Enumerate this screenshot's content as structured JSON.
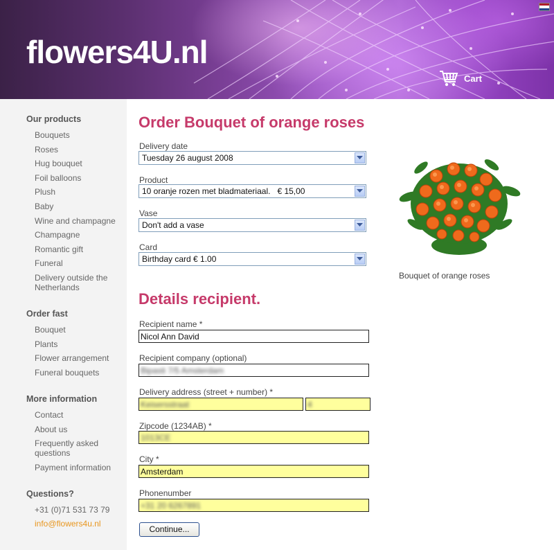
{
  "site": {
    "logo": "flowers4U.nl",
    "cart_label": "Cart"
  },
  "sidebar": {
    "sections": [
      {
        "heading": "Our products",
        "items": [
          "Bouquets",
          "Roses",
          "Hug bouquet",
          "Foil balloons",
          "Plush",
          "Baby",
          "Wine and champagne",
          "Champagne",
          "Romantic gift",
          "Funeral",
          "Delivery outside the Netherlands"
        ]
      },
      {
        "heading": "Order fast",
        "items": [
          "Bouquet",
          "Plants",
          "Flower arrangement",
          "Funeral bouquets"
        ]
      },
      {
        "heading": "More information",
        "items": [
          "Contact",
          "About us",
          "Frequently asked questions",
          "Payment information"
        ]
      },
      {
        "heading": "Questions?",
        "items": [
          "+31 (0)71 531 73 79",
          "info@flowers4u.nl"
        ]
      }
    ]
  },
  "order": {
    "title": "Order Bouquet of orange roses",
    "fields": [
      {
        "label": "Delivery date",
        "value": "Tuesday 26 august 2008"
      },
      {
        "label": "Product",
        "value": "10 oranje rozen met bladmateriaal.   € 15,00"
      },
      {
        "label": "Vase",
        "value": "Don't add a vase"
      },
      {
        "label": "Card",
        "value": "Birthday card € 1.00"
      }
    ],
    "image_caption": "Bouquet of orange roses"
  },
  "recipient": {
    "title": "Details recipient.",
    "name_label": "Recipient name *",
    "name_value": "Nicol Ann David",
    "company_label": "Recipient company (optional)",
    "company_value": "Bipasti 7/5 Amsterdam",
    "address_label": "Delivery address (street + number) *",
    "street_value": "Keisersstraat",
    "number_value": "4",
    "zip_label": "Zipcode (1234AB) *",
    "zip_value": "1013CE",
    "city_label": "City *",
    "city_value": "Amsterdam",
    "phone_label": "Phonenumber",
    "phone_value": "+31 20 6267891",
    "continue_label": "Continue..."
  },
  "colors": {
    "accent": "#c63a6a",
    "header_purple": "#9a55c0",
    "link_orange": "#e8961e",
    "highlight": "#ffff9d"
  }
}
